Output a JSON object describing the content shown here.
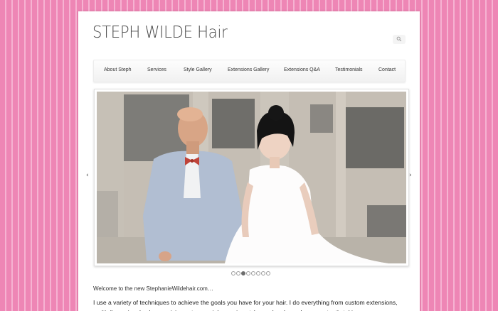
{
  "site": {
    "title": "STEPH WILDE Hair"
  },
  "search": {
    "icon": "search-icon"
  },
  "nav": {
    "items": [
      {
        "label": "About Steph"
      },
      {
        "label": "Services"
      },
      {
        "label": "Style Gallery"
      },
      {
        "label": "Extensions Gallery"
      },
      {
        "label": "Extensions Q&A"
      },
      {
        "label": "Testimonials"
      },
      {
        "label": "Contact"
      }
    ]
  },
  "slider": {
    "slide_count": 8,
    "active_index": 2,
    "prev_label": "‹",
    "next_label": "›"
  },
  "content": {
    "welcome": "Welcome to the new StephanieWildehair.com…",
    "intro": "I use a variety of techniques to achieve the goals you have for your hair. I do everything from custom extensions, multi-dimensional color, precision cuts, special occasion styles and makeup. I am constantly taking"
  },
  "colors": {
    "background": "#ee86b5",
    "stripe": "#f6b3d2",
    "page": "#ffffff"
  }
}
